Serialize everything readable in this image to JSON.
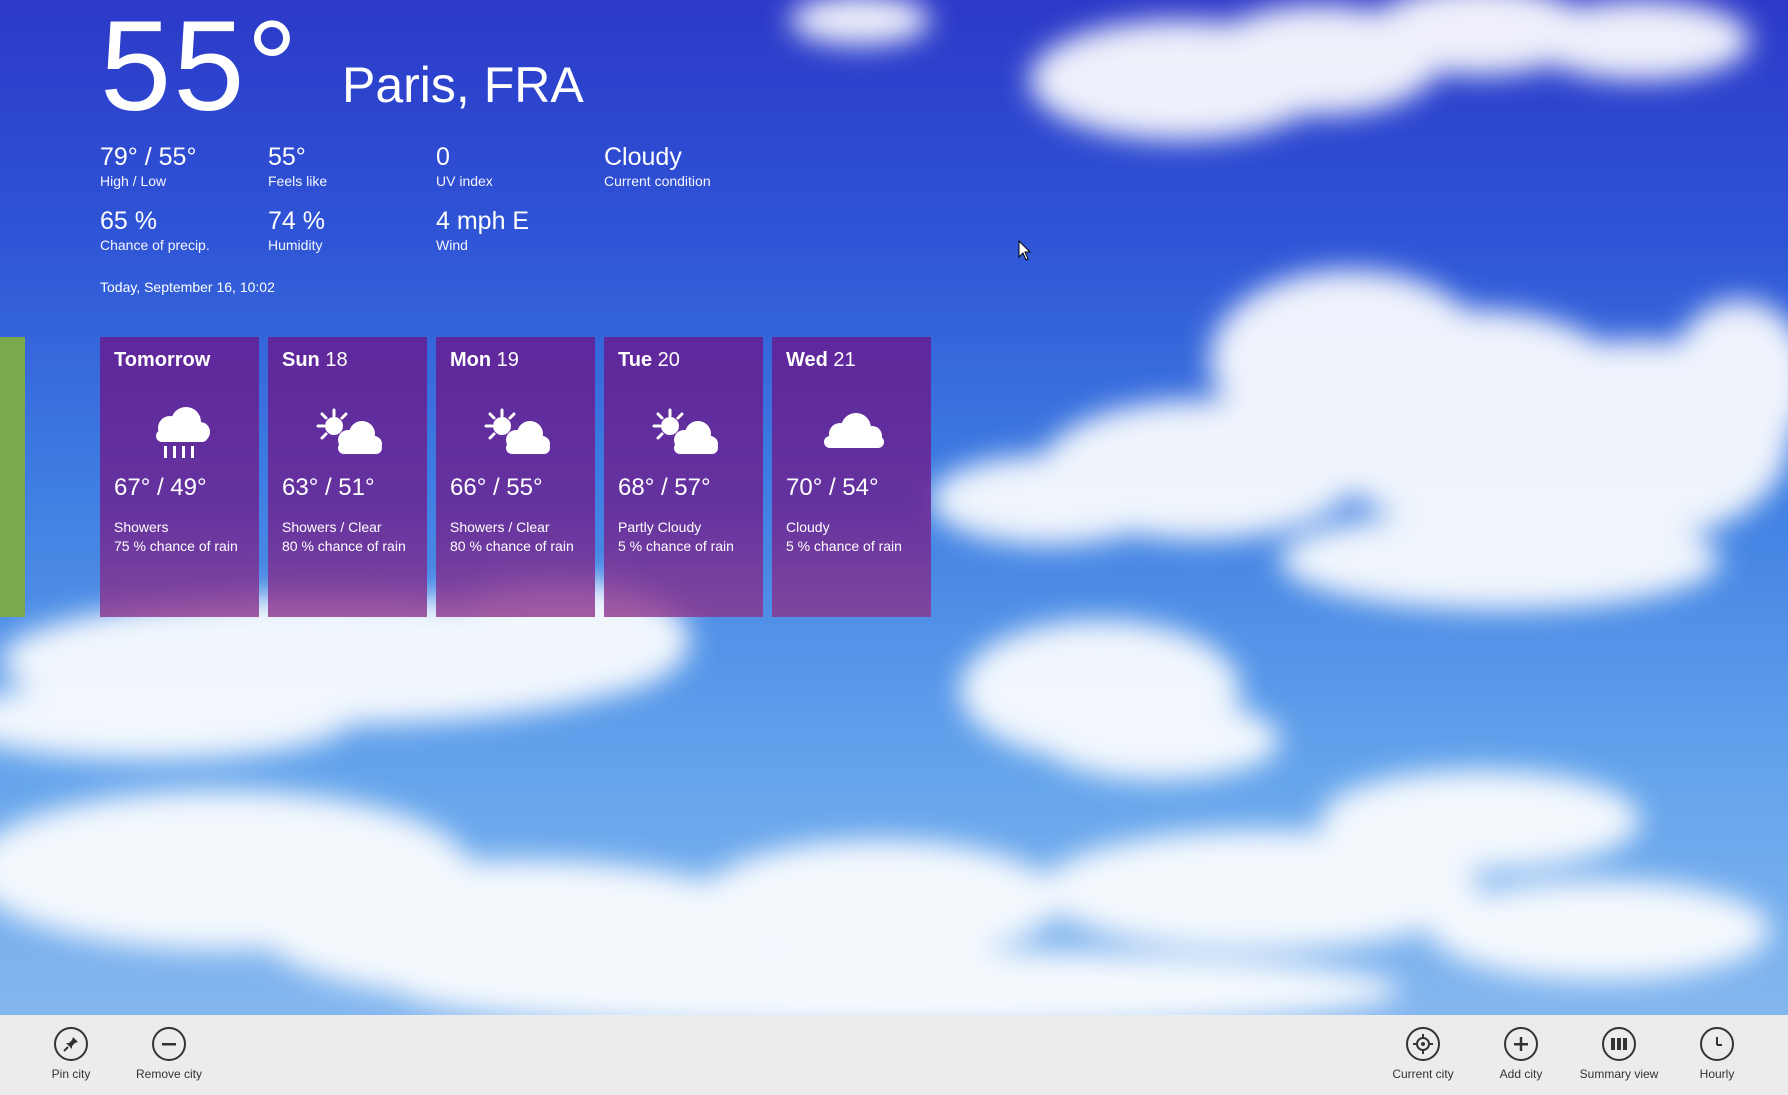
{
  "current": {
    "temperature": "55°",
    "city": "Paris, FRA",
    "stats": [
      {
        "value": "79° / 55°",
        "label": "High / Low"
      },
      {
        "value": "55°",
        "label": "Feels like"
      },
      {
        "value": "0",
        "label": "UV index"
      },
      {
        "value": "Cloudy",
        "label": "Current condition"
      },
      {
        "value": "65 %",
        "label": "Chance of precip."
      },
      {
        "value": "74 %",
        "label": "Humidity"
      },
      {
        "value": "4 mph E",
        "label": "Wind"
      }
    ],
    "updated": "Today, September 16, 10:02"
  },
  "forecast": [
    {
      "day": "Tomorrow",
      "date": "",
      "icon": "rain-cloud-icon",
      "temps": "67° / 49°",
      "condition": "Showers",
      "rain": "75 % chance of rain"
    },
    {
      "day": "Sun",
      "date": "18",
      "icon": "sun-cloud-icon",
      "temps": "63° / 51°",
      "condition": "Showers / Clear",
      "rain": "80 % chance of rain"
    },
    {
      "day": "Mon",
      "date": "19",
      "icon": "sun-cloud-icon",
      "temps": "66° / 55°",
      "condition": "Showers / Clear",
      "rain": "80 % chance of rain"
    },
    {
      "day": "Tue",
      "date": "20",
      "icon": "sun-cloud-icon",
      "temps": "68° / 57°",
      "condition": "Partly Cloudy",
      "rain": "5 % chance of rain"
    },
    {
      "day": "Wed",
      "date": "21",
      "icon": "cloud-icon",
      "temps": "70° / 54°",
      "condition": "Cloudy",
      "rain": "5 % chance of rain"
    }
  ],
  "appbar": {
    "left": [
      {
        "label": "Pin city",
        "icon": "pin-icon"
      },
      {
        "label": "Remove city",
        "icon": "minus-circle-icon"
      }
    ],
    "right": [
      {
        "label": "Current city",
        "icon": "crosshair-icon"
      },
      {
        "label": "Add city",
        "icon": "plus-circle-icon"
      },
      {
        "label": "Summary view",
        "icon": "summary-view-icon"
      },
      {
        "label": "Hourly",
        "icon": "clock-icon"
      }
    ]
  },
  "colors": {
    "card": "#6a2896",
    "appbar": "#ececec",
    "sky_top": "#2c39c8",
    "sky_bottom": "#8fbdf0",
    "side_strip": "#7aa84a"
  }
}
